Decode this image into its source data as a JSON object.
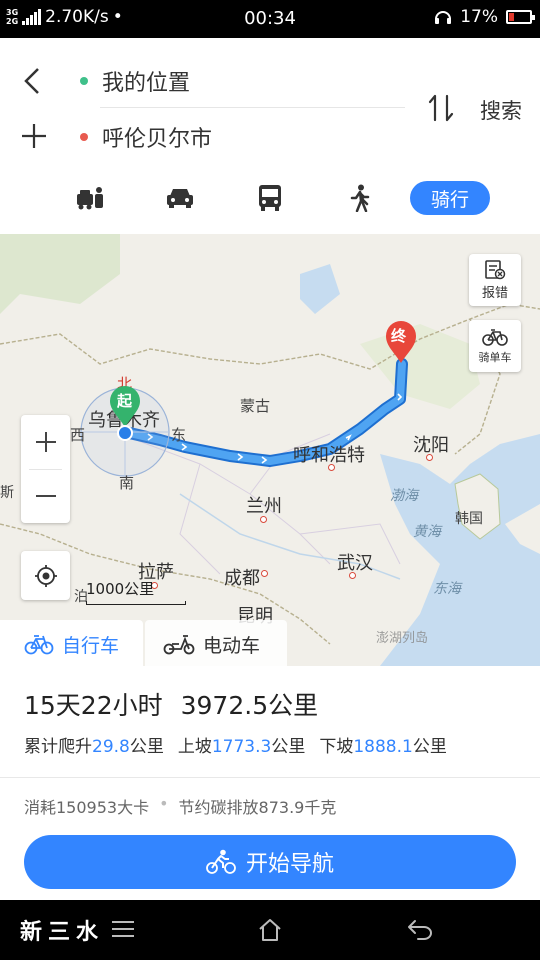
{
  "status_bar": {
    "network_types": [
      "3G",
      "2G"
    ],
    "speed": "2.70K/s",
    "time": "00:34",
    "battery": "17%",
    "battery_color": "#e23a2d"
  },
  "route": {
    "start": "我的位置",
    "end": "呼伦贝尔市",
    "search_label": "搜索",
    "start_color": "#3fc08a",
    "end_color": "#e85a4f"
  },
  "modes": {
    "items": [
      "taxi-icon",
      "car-icon",
      "bus-icon",
      "walk-icon"
    ],
    "active_label": "骑行",
    "accent": "#3385ff"
  },
  "map": {
    "labels": {
      "mongolia": "蒙古",
      "hohhot": "呼和浩特",
      "shenyang": "沈阳",
      "lanzhou": "兰州",
      "lhasa": "拉萨",
      "chengdu": "成都",
      "wuhan": "武汉",
      "kunming": "昆明",
      "urumqi": "乌鲁木齐",
      "korea": "韩国",
      "bohai": "渤海",
      "yellow_sea": "黄海",
      "east_sea": "东海",
      "xinjiang_edge": "斯",
      "west_edge": "泊",
      "penghu": "澎湖列岛"
    },
    "compass": {
      "north": "北",
      "east": "东",
      "south": "南",
      "west": "西"
    },
    "start_marker": "起",
    "end_marker": "终",
    "report_label": "报错",
    "bike_label": "骑单车",
    "scale": "1000公里",
    "route_color": "#3a8ee6"
  },
  "vehicle_tabs": {
    "bike": "自行车",
    "ebike": "电动车"
  },
  "summary": {
    "duration": "15天22小时",
    "distance": "3972.5公里",
    "climb_label": "累计爬升",
    "climb_value": "29.8",
    "climb_unit": "公里",
    "up_label": "上坡",
    "up_value": "1773.3",
    "up_unit": "公里",
    "down_label": "下坡",
    "down_value": "1888.1",
    "down_unit": "公里",
    "calories": "消耗150953大卡",
    "carbon": "节约碳排放873.9千克",
    "nav_button": "开始导航"
  },
  "signature": "新三水"
}
